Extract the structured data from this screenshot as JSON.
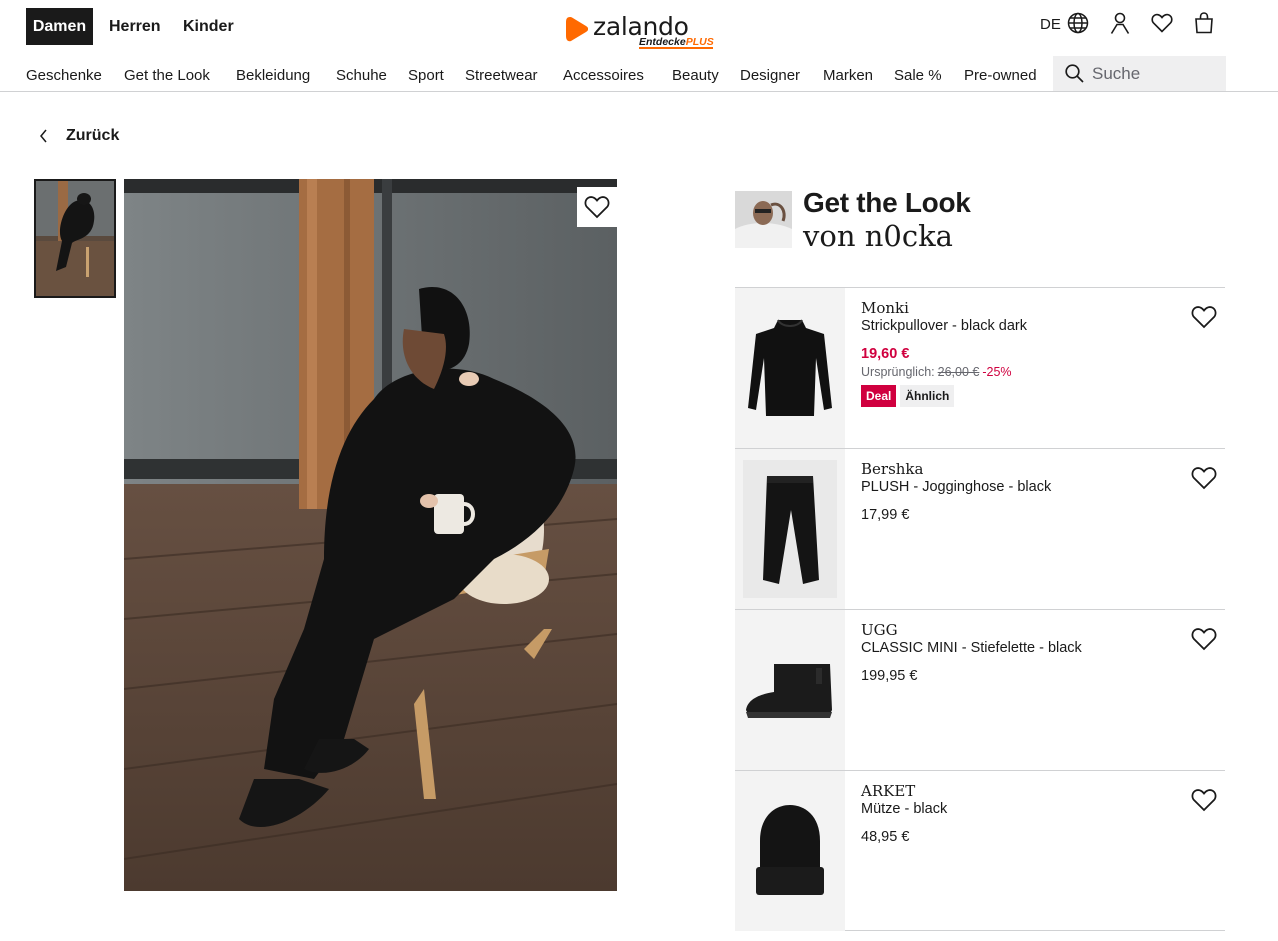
{
  "header": {
    "gender_tabs": [
      "Damen",
      "Herren",
      "Kinder"
    ],
    "logo": {
      "word": "zalando",
      "sub": "Entdecke",
      "plus": "PLUS"
    },
    "language": "DE",
    "icons": [
      "globe-icon",
      "user-icon",
      "heart-icon",
      "bag-icon"
    ]
  },
  "nav": {
    "items": [
      "Geschenke",
      "Get the Look",
      "Bekleidung",
      "Schuhe",
      "Sport",
      "Streetwear",
      "Accessoires",
      "Beauty",
      "Designer",
      "Marken",
      "Sale %",
      "Pre-owned"
    ],
    "search_placeholder": "Suche"
  },
  "back_label": "Zurück",
  "look": {
    "title": "Get the Look",
    "by": "von n0cka"
  },
  "products": [
    {
      "brand": "Monki",
      "name": "Strickpullover - black dark",
      "price": "19,60 €",
      "orig_label": "Ursprünglich:",
      "orig_price": "26,00 €",
      "discount": "-25%",
      "tags": [
        "Deal",
        "Ähnlich"
      ],
      "image": "sweater"
    },
    {
      "brand": "Bershka",
      "name": "PLUSH - Jogginghose - black",
      "price": "17,99 €",
      "image": "pants"
    },
    {
      "brand": "UGG",
      "name": "CLASSIC MINI - Stiefelette - black",
      "price": "199,95 €",
      "image": "boot"
    },
    {
      "brand": "ARKET",
      "name": "Mütze - black",
      "price": "48,95 €",
      "image": "beanie"
    }
  ],
  "colors": {
    "sale": "#d0003f",
    "brand_orange": "#ff6900",
    "text": "#1a1a1a",
    "muted": "#66676e"
  }
}
